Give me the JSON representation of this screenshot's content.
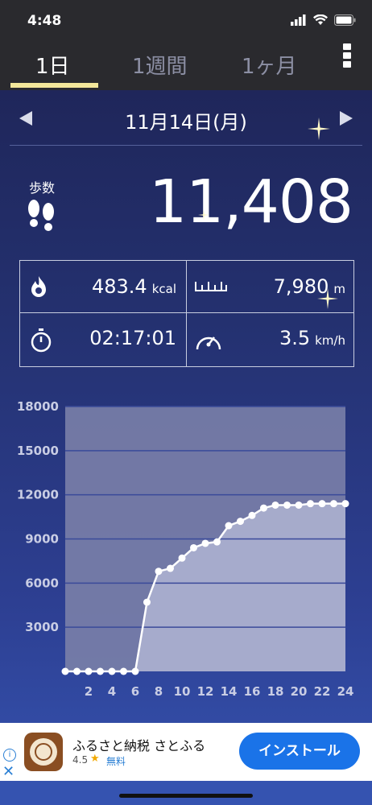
{
  "status_bar": {
    "time": "4:48"
  },
  "tabs": [
    {
      "label": "1日",
      "active": true
    },
    {
      "label": "1週間",
      "active": false
    },
    {
      "label": "1ヶ月",
      "active": false
    }
  ],
  "date": {
    "label": "11月14日(月)"
  },
  "steps": {
    "label": "歩数",
    "value": "11,408"
  },
  "stats": {
    "calories": {
      "value": "483.4",
      "unit": "kcal"
    },
    "distance": {
      "value": "7,980",
      "unit": "m"
    },
    "duration": {
      "value": "02:17:01"
    },
    "speed": {
      "value": "3.5",
      "unit": "km/h"
    }
  },
  "chart_data": {
    "type": "line",
    "x": [
      0,
      1,
      2,
      3,
      4,
      5,
      6,
      7,
      8,
      9,
      10,
      11,
      12,
      13,
      14,
      15,
      16,
      17,
      18,
      19,
      20,
      21,
      22,
      23,
      24
    ],
    "values": [
      0,
      0,
      0,
      0,
      0,
      0,
      0,
      4700,
      6800,
      7000,
      7700,
      8400,
      8700,
      8800,
      9900,
      10200,
      10600,
      11100,
      11300,
      11300,
      11300,
      11400,
      11400,
      11400,
      11400
    ],
    "xticks": [
      "2",
      "4",
      "6",
      "8",
      "10",
      "12",
      "14",
      "16",
      "18",
      "20",
      "22",
      "24"
    ],
    "yticks": [
      "3000",
      "6000",
      "9000",
      "12000",
      "15000",
      "18000"
    ],
    "ylim": [
      0,
      18000
    ],
    "xlim": [
      0,
      24
    ],
    "grid": true
  },
  "ad": {
    "title": "ふるさと納税 さとふる",
    "rating": "4.5",
    "price": "無料",
    "install_label": "インストール",
    "info_label": "i",
    "close_label": "✕"
  },
  "colors": {
    "accent_underline": "#f3e79a",
    "install_button": "#1a73e8",
    "chart_line": "#ffffff"
  }
}
